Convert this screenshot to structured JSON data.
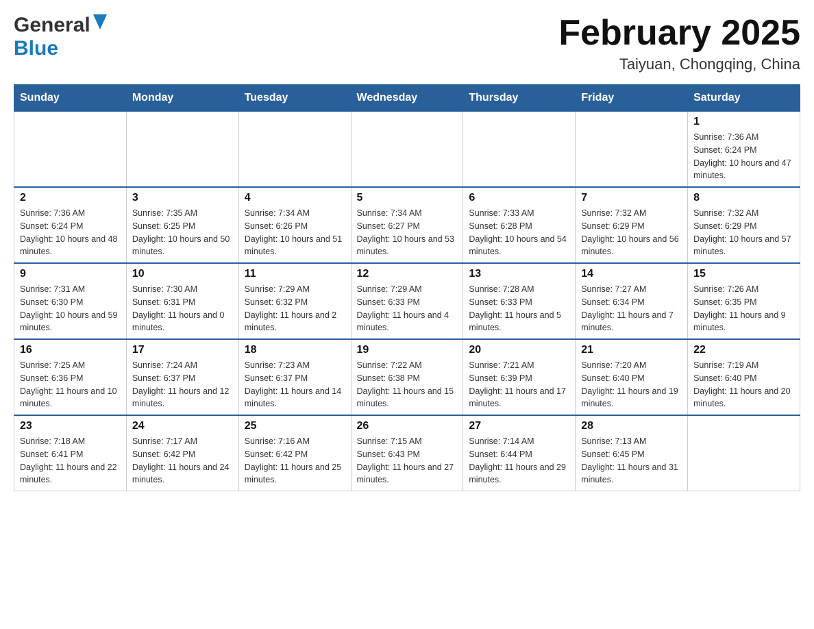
{
  "header": {
    "logo_line1": "General",
    "logo_line2": "Blue",
    "month_title": "February 2025",
    "location": "Taiyuan, Chongqing, China"
  },
  "weekdays": [
    "Sunday",
    "Monday",
    "Tuesday",
    "Wednesday",
    "Thursday",
    "Friday",
    "Saturday"
  ],
  "weeks": [
    {
      "days": [
        {
          "number": "",
          "sunrise": "",
          "sunset": "",
          "daylight": "",
          "empty": true
        },
        {
          "number": "",
          "sunrise": "",
          "sunset": "",
          "daylight": "",
          "empty": true
        },
        {
          "number": "",
          "sunrise": "",
          "sunset": "",
          "daylight": "",
          "empty": true
        },
        {
          "number": "",
          "sunrise": "",
          "sunset": "",
          "daylight": "",
          "empty": true
        },
        {
          "number": "",
          "sunrise": "",
          "sunset": "",
          "daylight": "",
          "empty": true
        },
        {
          "number": "",
          "sunrise": "",
          "sunset": "",
          "daylight": "",
          "empty": true
        },
        {
          "number": "1",
          "sunrise": "Sunrise: 7:36 AM",
          "sunset": "Sunset: 6:24 PM",
          "daylight": "Daylight: 10 hours and 47 minutes.",
          "empty": false
        }
      ]
    },
    {
      "days": [
        {
          "number": "2",
          "sunrise": "Sunrise: 7:36 AM",
          "sunset": "Sunset: 6:24 PM",
          "daylight": "Daylight: 10 hours and 48 minutes.",
          "empty": false
        },
        {
          "number": "3",
          "sunrise": "Sunrise: 7:35 AM",
          "sunset": "Sunset: 6:25 PM",
          "daylight": "Daylight: 10 hours and 50 minutes.",
          "empty": false
        },
        {
          "number": "4",
          "sunrise": "Sunrise: 7:34 AM",
          "sunset": "Sunset: 6:26 PM",
          "daylight": "Daylight: 10 hours and 51 minutes.",
          "empty": false
        },
        {
          "number": "5",
          "sunrise": "Sunrise: 7:34 AM",
          "sunset": "Sunset: 6:27 PM",
          "daylight": "Daylight: 10 hours and 53 minutes.",
          "empty": false
        },
        {
          "number": "6",
          "sunrise": "Sunrise: 7:33 AM",
          "sunset": "Sunset: 6:28 PM",
          "daylight": "Daylight: 10 hours and 54 minutes.",
          "empty": false
        },
        {
          "number": "7",
          "sunrise": "Sunrise: 7:32 AM",
          "sunset": "Sunset: 6:29 PM",
          "daylight": "Daylight: 10 hours and 56 minutes.",
          "empty": false
        },
        {
          "number": "8",
          "sunrise": "Sunrise: 7:32 AM",
          "sunset": "Sunset: 6:29 PM",
          "daylight": "Daylight: 10 hours and 57 minutes.",
          "empty": false
        }
      ]
    },
    {
      "days": [
        {
          "number": "9",
          "sunrise": "Sunrise: 7:31 AM",
          "sunset": "Sunset: 6:30 PM",
          "daylight": "Daylight: 10 hours and 59 minutes.",
          "empty": false
        },
        {
          "number": "10",
          "sunrise": "Sunrise: 7:30 AM",
          "sunset": "Sunset: 6:31 PM",
          "daylight": "Daylight: 11 hours and 0 minutes.",
          "empty": false
        },
        {
          "number": "11",
          "sunrise": "Sunrise: 7:29 AM",
          "sunset": "Sunset: 6:32 PM",
          "daylight": "Daylight: 11 hours and 2 minutes.",
          "empty": false
        },
        {
          "number": "12",
          "sunrise": "Sunrise: 7:29 AM",
          "sunset": "Sunset: 6:33 PM",
          "daylight": "Daylight: 11 hours and 4 minutes.",
          "empty": false
        },
        {
          "number": "13",
          "sunrise": "Sunrise: 7:28 AM",
          "sunset": "Sunset: 6:33 PM",
          "daylight": "Daylight: 11 hours and 5 minutes.",
          "empty": false
        },
        {
          "number": "14",
          "sunrise": "Sunrise: 7:27 AM",
          "sunset": "Sunset: 6:34 PM",
          "daylight": "Daylight: 11 hours and 7 minutes.",
          "empty": false
        },
        {
          "number": "15",
          "sunrise": "Sunrise: 7:26 AM",
          "sunset": "Sunset: 6:35 PM",
          "daylight": "Daylight: 11 hours and 9 minutes.",
          "empty": false
        }
      ]
    },
    {
      "days": [
        {
          "number": "16",
          "sunrise": "Sunrise: 7:25 AM",
          "sunset": "Sunset: 6:36 PM",
          "daylight": "Daylight: 11 hours and 10 minutes.",
          "empty": false
        },
        {
          "number": "17",
          "sunrise": "Sunrise: 7:24 AM",
          "sunset": "Sunset: 6:37 PM",
          "daylight": "Daylight: 11 hours and 12 minutes.",
          "empty": false
        },
        {
          "number": "18",
          "sunrise": "Sunrise: 7:23 AM",
          "sunset": "Sunset: 6:37 PM",
          "daylight": "Daylight: 11 hours and 14 minutes.",
          "empty": false
        },
        {
          "number": "19",
          "sunrise": "Sunrise: 7:22 AM",
          "sunset": "Sunset: 6:38 PM",
          "daylight": "Daylight: 11 hours and 15 minutes.",
          "empty": false
        },
        {
          "number": "20",
          "sunrise": "Sunrise: 7:21 AM",
          "sunset": "Sunset: 6:39 PM",
          "daylight": "Daylight: 11 hours and 17 minutes.",
          "empty": false
        },
        {
          "number": "21",
          "sunrise": "Sunrise: 7:20 AM",
          "sunset": "Sunset: 6:40 PM",
          "daylight": "Daylight: 11 hours and 19 minutes.",
          "empty": false
        },
        {
          "number": "22",
          "sunrise": "Sunrise: 7:19 AM",
          "sunset": "Sunset: 6:40 PM",
          "daylight": "Daylight: 11 hours and 20 minutes.",
          "empty": false
        }
      ]
    },
    {
      "days": [
        {
          "number": "23",
          "sunrise": "Sunrise: 7:18 AM",
          "sunset": "Sunset: 6:41 PM",
          "daylight": "Daylight: 11 hours and 22 minutes.",
          "empty": false
        },
        {
          "number": "24",
          "sunrise": "Sunrise: 7:17 AM",
          "sunset": "Sunset: 6:42 PM",
          "daylight": "Daylight: 11 hours and 24 minutes.",
          "empty": false
        },
        {
          "number": "25",
          "sunrise": "Sunrise: 7:16 AM",
          "sunset": "Sunset: 6:42 PM",
          "daylight": "Daylight: 11 hours and 25 minutes.",
          "empty": false
        },
        {
          "number": "26",
          "sunrise": "Sunrise: 7:15 AM",
          "sunset": "Sunset: 6:43 PM",
          "daylight": "Daylight: 11 hours and 27 minutes.",
          "empty": false
        },
        {
          "number": "27",
          "sunrise": "Sunrise: 7:14 AM",
          "sunset": "Sunset: 6:44 PM",
          "daylight": "Daylight: 11 hours and 29 minutes.",
          "empty": false
        },
        {
          "number": "28",
          "sunrise": "Sunrise: 7:13 AM",
          "sunset": "Sunset: 6:45 PM",
          "daylight": "Daylight: 11 hours and 31 minutes.",
          "empty": false
        },
        {
          "number": "",
          "sunrise": "",
          "sunset": "",
          "daylight": "",
          "empty": true
        }
      ]
    }
  ]
}
